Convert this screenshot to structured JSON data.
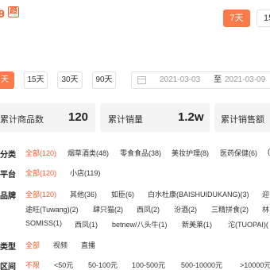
{
  "header": {
    "brand_text": "9",
    "brand_badge": "趋",
    "time_tabs": [
      "7天",
      "15"
    ]
  },
  "date_filter": {
    "ranges": [
      "天",
      "15天",
      "30天",
      "90天"
    ],
    "start_date": "2021-03-03",
    "separator": "至",
    "end_date": "2021-03-09"
  },
  "stats": [
    {
      "label": "累计商品数",
      "value": "120"
    },
    {
      "label": "累计销量",
      "value": "1.2w"
    },
    {
      "label": "累计销售额",
      "value": ""
    }
  ],
  "filters": {
    "category": {
      "label": "分类",
      "options": [
        "全部(120)",
        "烟草酒类(48)",
        "零食食品(38)",
        "美妆护理(8)",
        "医药保健(6)",
        "("
      ]
    },
    "platform": {
      "label": "平台",
      "options": [
        "全部(120)",
        "小店(119)"
      ]
    },
    "brand": {
      "label": "品牌",
      "row1": [
        "全部(120)",
        "其他(36)",
        "如臣(6)",
        "白水杜康(BAISHUIDUKANG)(3)",
        "迎"
      ],
      "row2": [
        "途旺(Tuwang)(2)",
        "肆只猫(2)",
        "西凤(2)",
        "汾酒(2)",
        "三精拼食(2)",
        "林"
      ],
      "row3": [
        "SOMISS(1)",
        "西凤(1)",
        "betnew/八头牛(1)",
        "新美莱(1)",
        "沱(TUOPAI)("
      ]
    },
    "type": {
      "label": "类型",
      "options": [
        "全部",
        "视频",
        "直播"
      ]
    },
    "price": {
      "label": "区间",
      "options": [
        "不限",
        "<50元",
        "50-100元",
        "100-500元",
        "500-10000元",
        ">10000元"
      ]
    }
  },
  "colors": {
    "accent": "#fa7a4a",
    "accent_text": "#f05a28",
    "card_bg": "#f4f4f4"
  }
}
